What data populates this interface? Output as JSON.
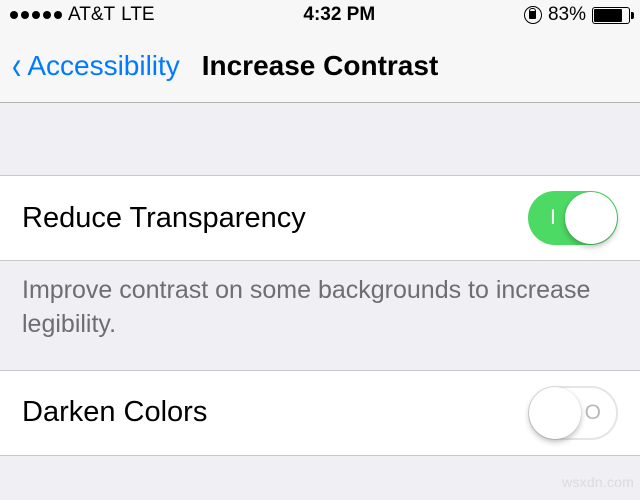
{
  "statusBar": {
    "carrier": "AT&T",
    "network": "LTE",
    "time": "4:32 PM",
    "batteryPercent": "83%",
    "batteryLevel": 83
  },
  "nav": {
    "backLabel": "Accessibility",
    "title": "Increase Contrast"
  },
  "rows": {
    "reduceTransparency": {
      "label": "Reduce Transparency",
      "on": true
    },
    "darkenColors": {
      "label": "Darken Colors",
      "on": false
    }
  },
  "footer": "Improve contrast on some backgrounds to increase legibility.",
  "watermark": "wsxdn.com"
}
